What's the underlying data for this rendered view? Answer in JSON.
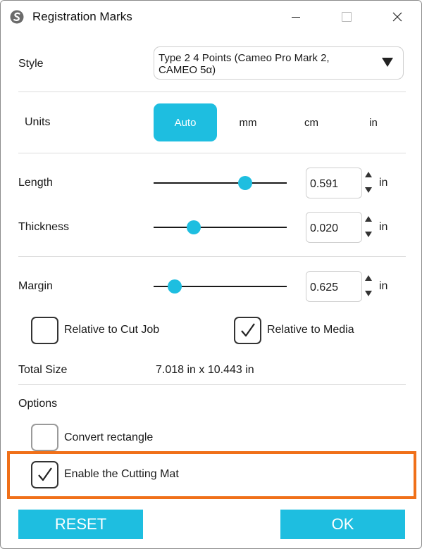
{
  "window": {
    "title": "Registration Marks",
    "icon": "silhouette-logo-icon"
  },
  "style": {
    "label": "Style",
    "value": "Type 2 4 Points (Cameo Pro Mark 2, CAMEO 5α)"
  },
  "units": {
    "label": "Units",
    "options": [
      "Auto",
      "mm",
      "cm",
      "in"
    ],
    "selected": "Auto"
  },
  "length": {
    "label": "Length",
    "value": "0.591",
    "unit": "in",
    "slider_fraction": 0.69
  },
  "thickness": {
    "label": "Thickness",
    "value": "0.020",
    "unit": "in",
    "slider_fraction": 0.3
  },
  "margin": {
    "label": "Margin",
    "value": "0.625",
    "unit": "in",
    "slider_fraction": 0.16
  },
  "relative": {
    "cut_job": {
      "label": "Relative to Cut Job",
      "checked": false
    },
    "media": {
      "label": "Relative to Media",
      "checked": true
    }
  },
  "total_size": {
    "label": "Total Size",
    "value": "7.018 in x 10.443 in"
  },
  "options": {
    "label": "Options",
    "convert_rectangle": {
      "label": "Convert rectangle",
      "checked": false
    },
    "cutting_mat": {
      "label": "Enable the Cutting Mat",
      "checked": true
    }
  },
  "buttons": {
    "reset": "RESET",
    "ok": "OK"
  },
  "colors": {
    "accent": "#1ebee0",
    "highlight": "#f07019"
  }
}
